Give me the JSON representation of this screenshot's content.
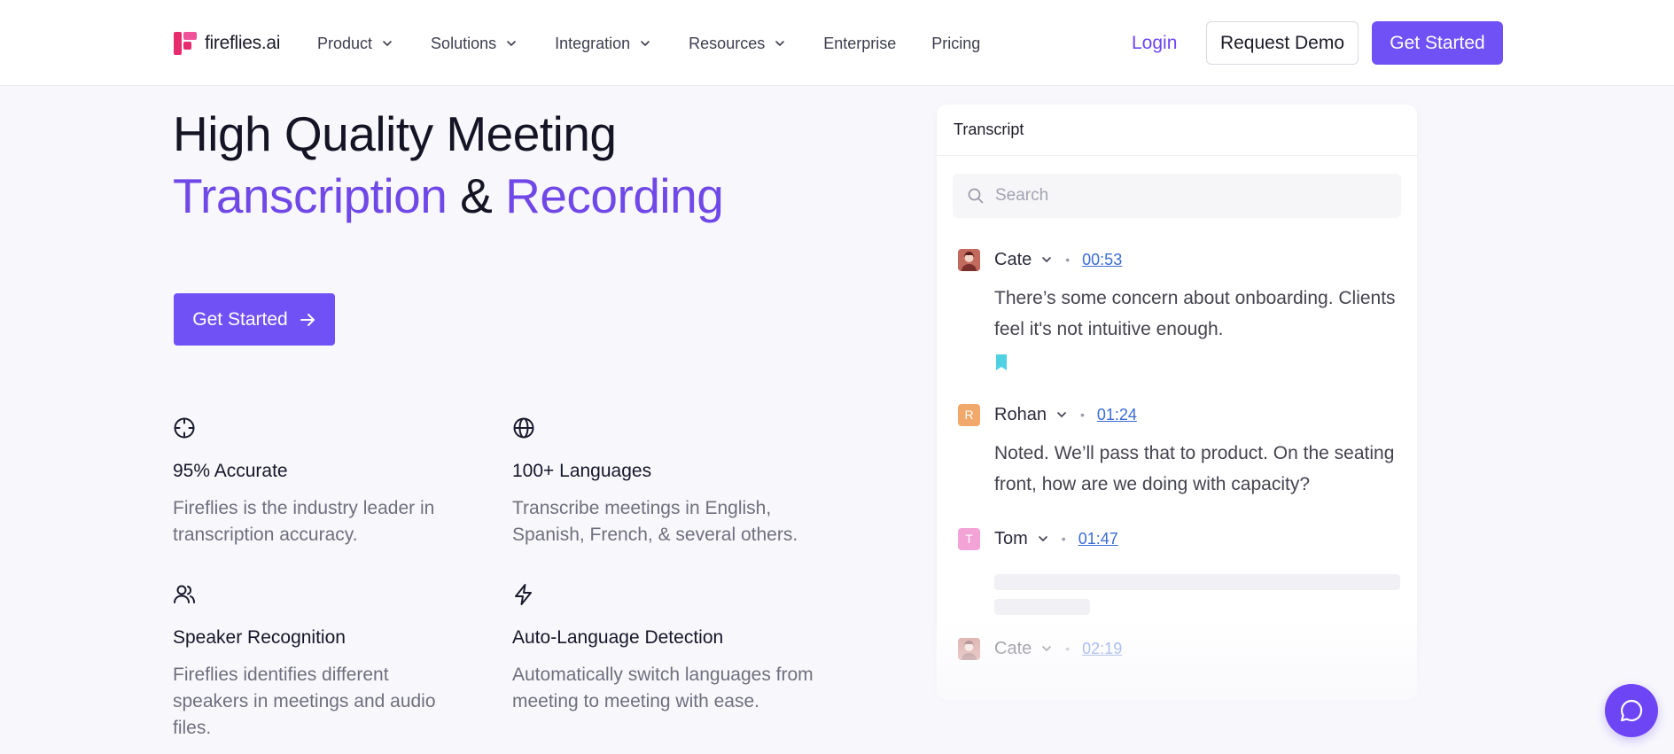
{
  "header": {
    "logo_text": "fireflies.ai",
    "nav": [
      {
        "label": "Product",
        "has_dropdown": true,
        "icon": "chevron-down-icon"
      },
      {
        "label": "Solutions",
        "has_dropdown": true,
        "icon": "chevron-down-icon"
      },
      {
        "label": "Integration",
        "has_dropdown": true,
        "icon": "chevron-down-icon"
      },
      {
        "label": "Resources",
        "has_dropdown": true,
        "icon": "chevron-down-icon"
      },
      {
        "label": "Enterprise",
        "has_dropdown": false
      },
      {
        "label": "Pricing",
        "has_dropdown": false
      }
    ],
    "login_label": "Login",
    "demo_label": "Request Demo",
    "get_started_label": "Get Started"
  },
  "hero": {
    "title_line1": "High Quality Meeting",
    "title_accent1": "Transcription",
    "title_amp": "&",
    "title_accent2": "Recording",
    "cta_label": "Get Started",
    "cta_icon": "arrow-right-icon"
  },
  "features": [
    {
      "icon": "crosshair-icon",
      "title": "95% Accurate",
      "desc": "Fireflies is the industry leader in transcription accuracy."
    },
    {
      "icon": "globe-icon",
      "title": "100+ Languages",
      "desc": "Transcribe meetings in English, Spanish, French, & several others."
    },
    {
      "icon": "users-icon",
      "title": "Speaker Recognition",
      "desc": "Fireflies identifies different speakers in meetings and audio files."
    },
    {
      "icon": "lightning-icon",
      "title": "Auto-Language Detection",
      "desc": "Automatically switch languages from meeting to meeting with ease."
    }
  ],
  "transcript": {
    "title": "Transcript",
    "search_placeholder": "Search",
    "entries": [
      {
        "speaker": "Cate",
        "initial": "",
        "avatar_color": "#b0524e",
        "time": "00:53",
        "text": "There’s some concern about onboarding. Clients feel it's not intuitive enough."
      },
      {
        "speaker": "Rohan",
        "initial": "R",
        "avatar_color": "#f0a96a",
        "time": "01:24",
        "text": "Noted. We’ll pass that to product. On the seating front, how are we doing with capacity?"
      },
      {
        "speaker": "Tom",
        "initial": "T",
        "avatar_color": "#f4a3d7",
        "time": "01:47",
        "text": ""
      },
      {
        "speaker": "Cate",
        "initial": "",
        "avatar_color": "#c98b8a",
        "time": "02:19",
        "text": ""
      }
    ]
  },
  "colors": {
    "brand": "#7051f5",
    "accent_text": "#7048e8",
    "link": "#3b6bd6",
    "bookmark": "#4fd0e3"
  }
}
